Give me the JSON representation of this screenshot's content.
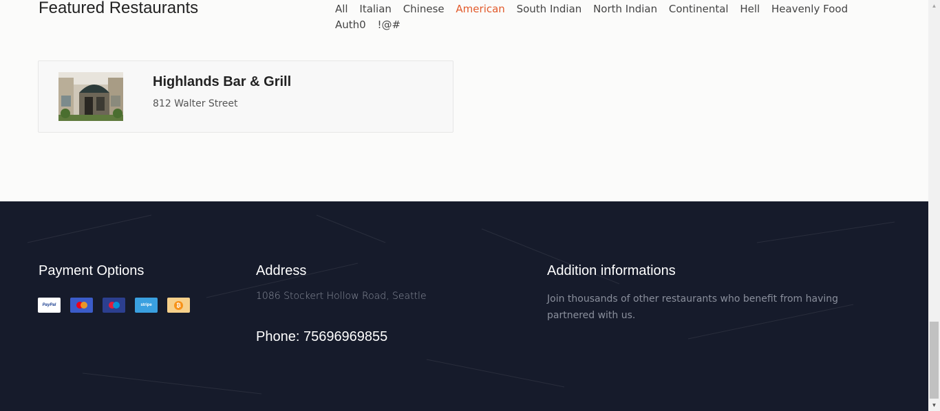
{
  "main": {
    "section_title": "Featured Restaurants",
    "filters": [
      "All",
      "Italian",
      "Chinese",
      "American",
      "South Indian",
      "North Indian",
      "Continental",
      "Hell",
      "Heavenly Food",
      "Auth0",
      "!@#"
    ],
    "active_filter": "American",
    "accent_color": "#e25a2b"
  },
  "restaurant": {
    "name": "Highlands Bar & Grill",
    "address": "812 Walter Street"
  },
  "footer": {
    "payment_title": "Payment Options",
    "payments": [
      {
        "name": "paypal-icon",
        "label": "PayPal"
      },
      {
        "name": "mastercard-icon",
        "label": ""
      },
      {
        "name": "maestro-icon",
        "label": ""
      },
      {
        "name": "stripe-icon",
        "label": "stripe"
      },
      {
        "name": "bitcoin-icon",
        "label": "₿"
      }
    ],
    "address_title": "Address",
    "address_text": "1086 Stockert Hollow Road, Seattle",
    "phone": "Phone: 75696969855",
    "info_title": "Addition informations",
    "info_text": "Join thousands of other restaurants who benefit from having partnered with us.",
    "background_color": "#161b2b"
  }
}
